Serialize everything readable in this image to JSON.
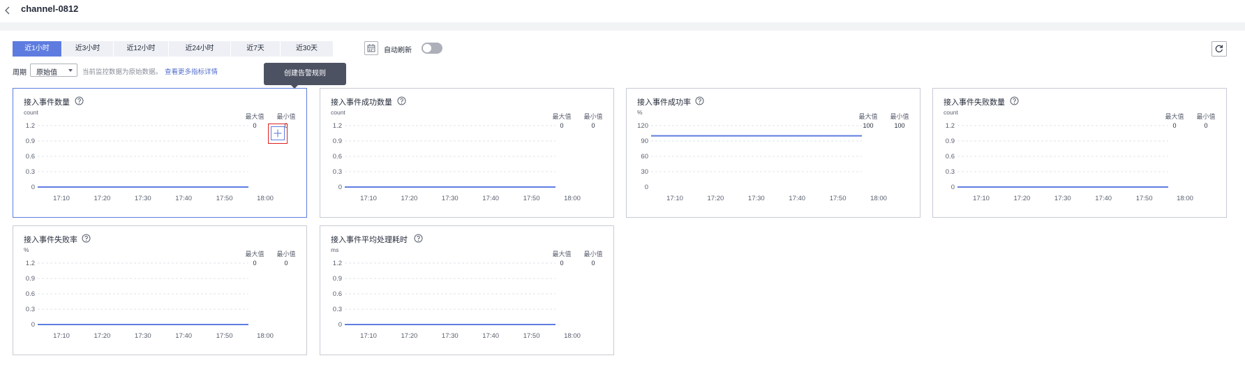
{
  "header": {
    "title": "channel-0812"
  },
  "toolbar": {
    "tabs": [
      "近1小时",
      "近3小时",
      "近12小时",
      "近24小时",
      "近7天",
      "近30天"
    ],
    "active_tab": "近1小时",
    "auto_refresh_label": "自动刷新",
    "auto_refresh_on": false,
    "period_label": "周期",
    "period_value": "原始值",
    "note": "当前监控数据为原始数据。",
    "note_link": "查看更多指标详情"
  },
  "tooltip": {
    "text": "创建告警规则"
  },
  "icons": {
    "back": "chevron-left-icon",
    "calendar": "calendar-icon",
    "refresh": "refresh-icon",
    "help": "question-circle-icon",
    "add": "plus-icon"
  },
  "colors": {
    "accent": "#5e7ce0",
    "highlight": "#e02020"
  },
  "chart_data": [
    {
      "type": "line",
      "title": "接入事件数量",
      "ylabel": "count",
      "stats": {
        "max_label": "最大值",
        "max": "0",
        "min_label": "最小值",
        "min": "0"
      },
      "yticks": [
        "1.2",
        "0.9",
        "0.6",
        "0.3",
        "0"
      ],
      "ylim": [
        0,
        1.2
      ],
      "xticks": [
        "17:10",
        "17:20",
        "17:30",
        "17:40",
        "17:50",
        "18:00"
      ],
      "series": [
        {
          "values": [
            0,
            0,
            0,
            0,
            0,
            0
          ]
        }
      ]
    },
    {
      "type": "line",
      "title": "接入事件成功数量",
      "ylabel": "count",
      "stats": {
        "max_label": "最大值",
        "max": "0",
        "min_label": "最小值",
        "min": "0"
      },
      "yticks": [
        "1.2",
        "0.9",
        "0.6",
        "0.3",
        "0"
      ],
      "ylim": [
        0,
        1.2
      ],
      "xticks": [
        "17:10",
        "17:20",
        "17:30",
        "17:40",
        "17:50",
        "18:00"
      ],
      "series": [
        {
          "values": [
            0,
            0,
            0,
            0,
            0,
            0
          ]
        }
      ]
    },
    {
      "type": "line",
      "title": "接入事件成功率",
      "ylabel": "%",
      "stats": {
        "max_label": "最大值",
        "max": "100",
        "min_label": "最小值",
        "min": "100"
      },
      "yticks": [
        "120",
        "90",
        "60",
        "30",
        "0"
      ],
      "ylim": [
        0,
        120
      ],
      "xticks": [
        "17:10",
        "17:20",
        "17:30",
        "17:40",
        "17:50",
        "18:00"
      ],
      "series": [
        {
          "values": [
            100,
            100,
            100,
            100,
            100,
            100
          ]
        }
      ]
    },
    {
      "type": "line",
      "title": "接入事件失败数量",
      "ylabel": "count",
      "stats": {
        "max_label": "最大值",
        "max": "0",
        "min_label": "最小值",
        "min": "0"
      },
      "yticks": [
        "1.2",
        "0.9",
        "0.6",
        "0.3",
        "0"
      ],
      "ylim": [
        0,
        1.2
      ],
      "xticks": [
        "17:10",
        "17:20",
        "17:30",
        "17:40",
        "17:50",
        "18:00"
      ],
      "series": [
        {
          "values": [
            0,
            0,
            0,
            0,
            0,
            0
          ]
        }
      ]
    },
    {
      "type": "line",
      "title": "接入事件失败率",
      "ylabel": "%",
      "stats": {
        "max_label": "最大值",
        "max": "0",
        "min_label": "最小值",
        "min": "0"
      },
      "yticks": [
        "1.2",
        "0.9",
        "0.6",
        "0.3",
        "0"
      ],
      "ylim": [
        0,
        1.2
      ],
      "xticks": [
        "17:10",
        "17:20",
        "17:30",
        "17:40",
        "17:50",
        "18:00"
      ],
      "series": [
        {
          "values": [
            0,
            0,
            0,
            0,
            0,
            0
          ]
        }
      ]
    },
    {
      "type": "line",
      "title": "接入事件平均处理耗时",
      "ylabel": "ms",
      "stats": {
        "max_label": "最大值",
        "max": "0",
        "min_label": "最小值",
        "min": "0"
      },
      "yticks": [
        "1.2",
        "0.9",
        "0.6",
        "0.3",
        "0"
      ],
      "ylim": [
        0,
        1.2
      ],
      "xticks": [
        "17:10",
        "17:20",
        "17:30",
        "17:40",
        "17:50",
        "18:00"
      ],
      "series": [
        {
          "values": [
            0,
            0,
            0,
            0,
            0,
            0
          ]
        }
      ]
    }
  ]
}
